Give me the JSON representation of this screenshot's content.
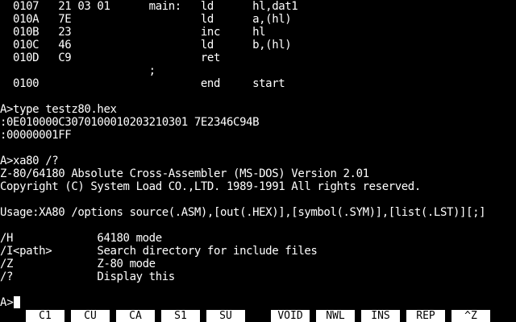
{
  "terminal": {
    "lines": [
      "  0107   21 03 01      main:   ld      hl,dat1",
      "  010A   7E                    ld      a,(hl)",
      "  010B   23                    inc     hl",
      "  010C   46                    ld      b,(hl)",
      "  010D   C9                    ret",
      "                       ;",
      "  0100                         end     start",
      "",
      "A>type testz80.hex",
      ":0E010000C3070100010203210301 7E2346C94B",
      ":00000001FF",
      "",
      "A>xa80 /?",
      "Z-80/64180 Absolute Cross-Assembler (MS-DOS) Version 2.01",
      "Copyright (C) System Load CO.,LTD. 1989-1991 All rights reserved.",
      "",
      "Usage:XA80 /options source(.ASM),[out(.HEX)],[symbol(.SYM)],[list(.LST)][;]",
      "",
      "/H             64180 mode",
      "/I<path>       Search directory for include files",
      "/Z             Z-80 mode",
      "/?             Display this"
    ],
    "prompt": "A>"
  },
  "function_keys": [
    {
      "label": "C1"
    },
    {
      "label": "CU"
    },
    {
      "label": "CA"
    },
    {
      "label": "S1"
    },
    {
      "label": "SU"
    },
    {
      "label": "VOID"
    },
    {
      "label": "NWL"
    },
    {
      "label": "INS"
    },
    {
      "label": "REP"
    },
    {
      "label": "^Z"
    }
  ],
  "colors": {
    "background": "#000000",
    "foreground": "#ffffff",
    "fkey_background": "#ffffff",
    "fkey_text": "#000000"
  }
}
